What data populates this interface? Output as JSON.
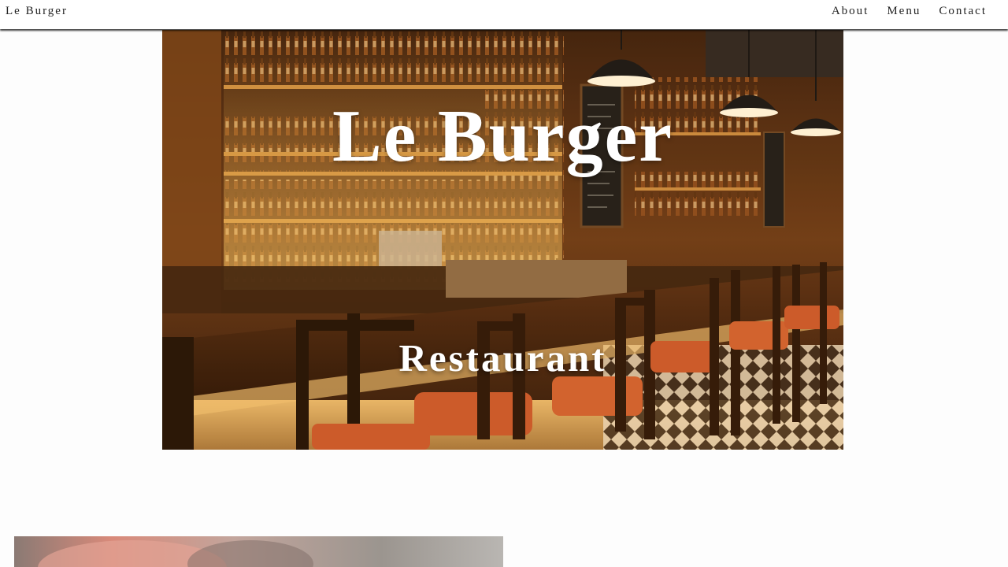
{
  "header": {
    "brand": "Le Burger",
    "nav": [
      {
        "label": "About"
      },
      {
        "label": "Menu"
      },
      {
        "label": "Contact"
      }
    ]
  },
  "hero": {
    "title": "Le Burger",
    "subtitle": "Restaurant",
    "image_subject": "restaurant bar interior with stools and pendant lamps"
  },
  "colors": {
    "header_bg": "#ffffff",
    "page_bg": "#fdfdfd",
    "hero_text": "#ffffff",
    "stool_seat": "#c9582a"
  }
}
